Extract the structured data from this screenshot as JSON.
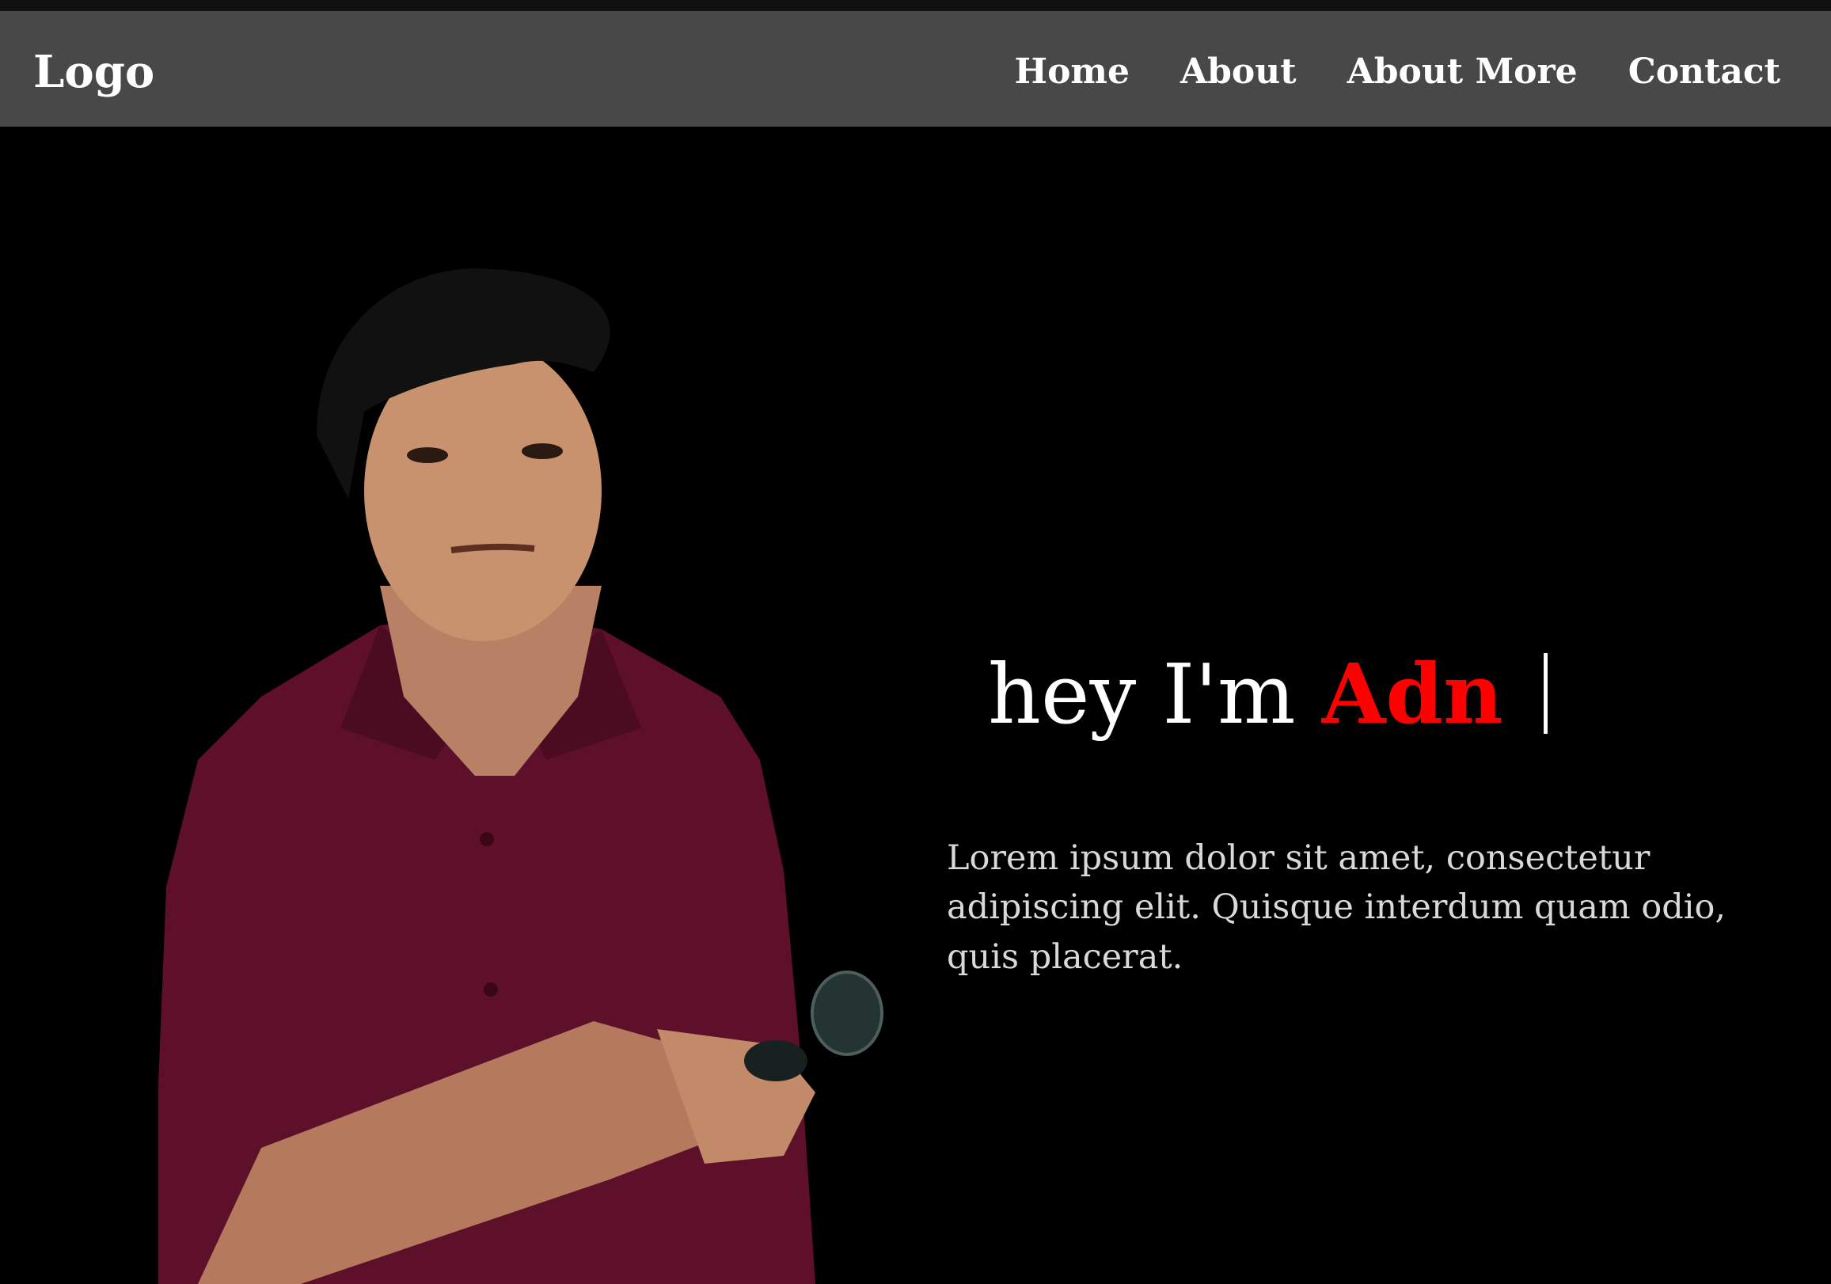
{
  "nav": {
    "logo": "Logo",
    "links": [
      "Home",
      "About",
      "About More",
      "Contact"
    ]
  },
  "hero": {
    "greeting": "hey I'm",
    "name": "Adn",
    "description": "Lorem ipsum dolor sit amet, consectetur adipiscing elit. Quisque interdum quam odio, quis placerat."
  },
  "colors": {
    "background": "#000000",
    "navbar": "#484848",
    "accent": "#ff0000",
    "shirt": "#5e0f2a"
  }
}
